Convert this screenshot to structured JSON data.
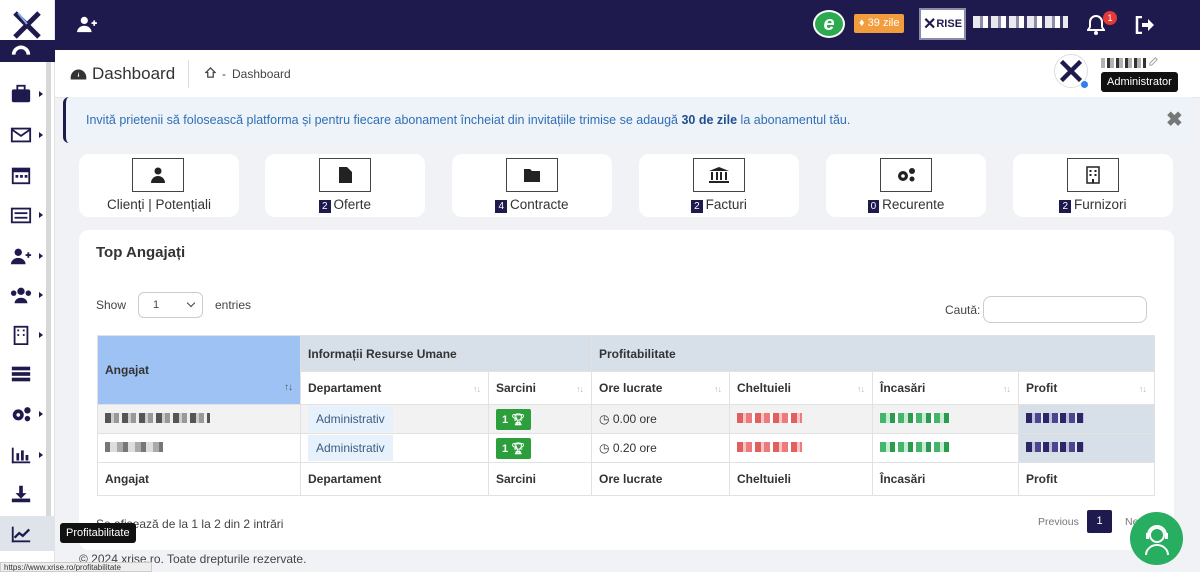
{
  "topbar": {
    "days_badge": "39 zile",
    "brand": "RISE",
    "notifications_count": "1"
  },
  "breadcrumb": {
    "page_title": "Dashboard",
    "crumb": "Dashboard",
    "sep": "-"
  },
  "tooltips": {
    "role": "Administrator",
    "sidebar_hover": "Profitabilitate"
  },
  "alert": {
    "text_before": "Invită prietenii să folosească platforma și pentru fiecare abonament încheiat din invitațiile trimise se adaugă ",
    "bold": "30 de zile",
    "text_after": " la abonamentul tău.",
    "close": "✖"
  },
  "cards": [
    {
      "label": "Clienți | Potențiali",
      "count": ""
    },
    {
      "label": "Oferte",
      "count": "2"
    },
    {
      "label": "Contracte",
      "count": "4"
    },
    {
      "label": "Facturi",
      "count": "2"
    },
    {
      "label": "Recurente",
      "count": "0"
    },
    {
      "label": "Furnizori",
      "count": "2"
    }
  ],
  "panel": {
    "title": "Top Angajați",
    "show": "Show",
    "entries_value": "1",
    "entries": "entries",
    "search_label": "Caută:",
    "info": "Se afișează de la 1 la 2 din 2 intrări",
    "previous": "Previous",
    "page": "1",
    "next": "Next"
  },
  "table": {
    "group_headers": {
      "angajat": "Angajat",
      "hr": "Informații Resurse Umane",
      "profit": "Profitabilitate"
    },
    "columns": [
      "Departament",
      "Sarcini",
      "Ore lucrate",
      "Cheltuieli",
      "Încasări",
      "Profit"
    ],
    "rows": [
      {
        "dept": "Administrativ",
        "tasks": "1",
        "hours": "0.00 ore"
      },
      {
        "dept": "Administrativ",
        "tasks": "1",
        "hours": "0.20 ore"
      }
    ],
    "footer": [
      "Angajat",
      "Departament",
      "Sarcini",
      "Ore lucrate",
      "Cheltuieli",
      "Încasări",
      "Profit"
    ]
  },
  "footer": {
    "copyright": "© 2024 xrise.ro. Toate drepturile rezervate.",
    "status_url": "https://www.xrise.ro/profitabilitate"
  },
  "colors": {
    "navy": "#1f1a4d",
    "accent_blue": "#9fc2f5",
    "success_green": "#2c9f3c",
    "warning_orange": "#f39c3d"
  }
}
